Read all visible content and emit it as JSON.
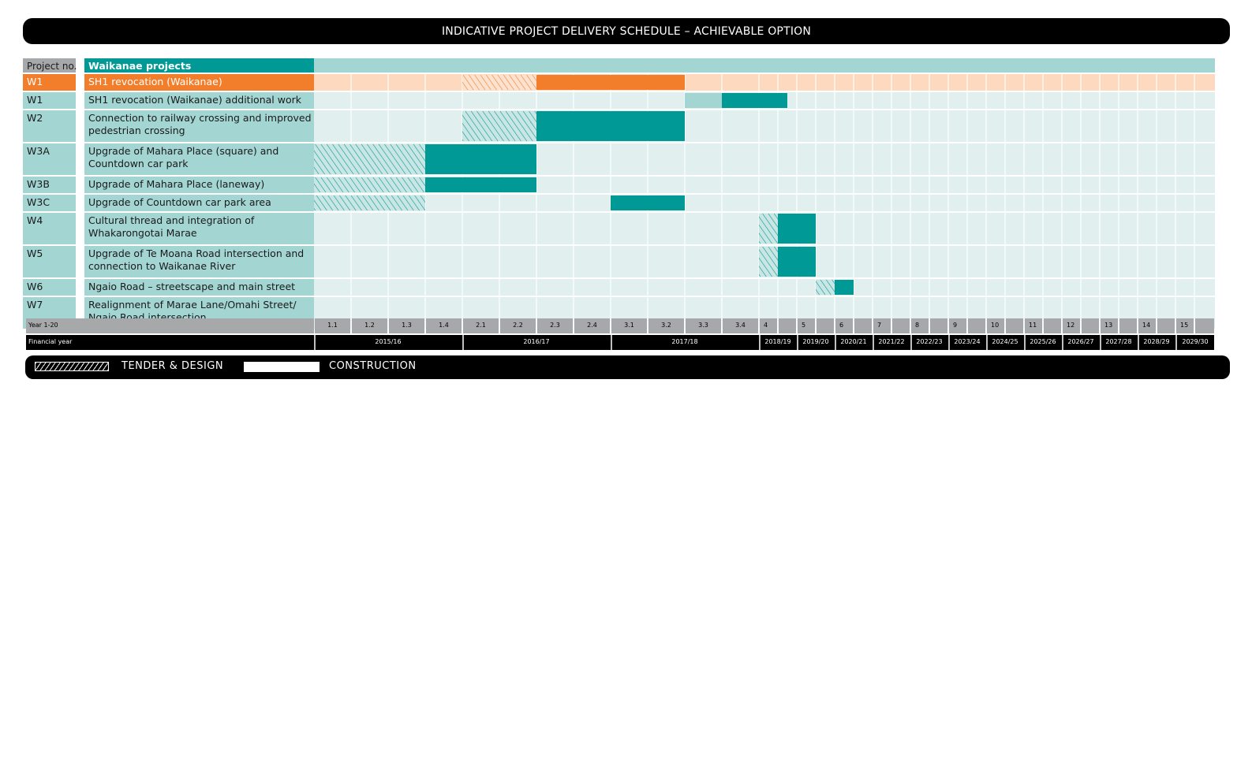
{
  "title": "INDICATIVE PROJECT DELIVERY SCHEDULE – ACHIEVABLE OPTION",
  "colors": {
    "teal": "#009995",
    "teal_light": "#a3d5d3",
    "teal_bg": "#e1f0ef",
    "orange": "#f27d2a",
    "orange_light": "#fcd9bf",
    "grey": "#a7a8aa",
    "black": "#000000"
  },
  "legend": {
    "tender_label": "TENDER & DESIGN",
    "construction_label": "CONSTRUCTION"
  },
  "chart_data": {
    "type": "gantt",
    "header": {
      "project_no_label": "Project no.",
      "group_label": "Waikanae projects"
    },
    "periods": [
      "1.1",
      "1.2",
      "1.3",
      "1.4",
      "2.1",
      "2.2",
      "2.3",
      "2.4",
      "3.1",
      "3.2",
      "3.3",
      "3.4",
      "4",
      "",
      "5",
      "",
      "6",
      "",
      "7",
      "",
      "8",
      "",
      "9",
      "",
      "10",
      "",
      "11",
      "",
      "12",
      "",
      "13",
      "",
      "14",
      "",
      "15",
      ""
    ],
    "period_axis_label": "Year 1-20",
    "financial_year_label": "Financial year",
    "financial_years": [
      {
        "label": "2015/16",
        "start": 0,
        "end": 4
      },
      {
        "label": "2016/17",
        "start": 4,
        "end": 8
      },
      {
        "label": "2017/18",
        "start": 8,
        "end": 12
      },
      {
        "label": "2018/19",
        "start": 12,
        "end": 14
      },
      {
        "label": "2019/20",
        "start": 14,
        "end": 16
      },
      {
        "label": "2020/21",
        "start": 16,
        "end": 18
      },
      {
        "label": "2021/22",
        "start": 18,
        "end": 20
      },
      {
        "label": "2022/23",
        "start": 20,
        "end": 22
      },
      {
        "label": "2023/24",
        "start": 22,
        "end": 24
      },
      {
        "label": "2024/25",
        "start": 24,
        "end": 26
      },
      {
        "label": "2025/26",
        "start": 26,
        "end": 28
      },
      {
        "label": "2026/27",
        "start": 28,
        "end": 30
      },
      {
        "label": "2027/28",
        "start": 30,
        "end": 32
      },
      {
        "label": "2028/29",
        "start": 32,
        "end": 34
      },
      {
        "label": "2029/30",
        "start": 34,
        "end": 36
      }
    ],
    "projects": [
      {
        "no": "W1",
        "name": [
          "SH1 revocation (Waikanae)"
        ],
        "highlight": true,
        "tender": [
          4,
          6
        ],
        "construction": [
          6,
          10
        ]
      },
      {
        "no": "W1",
        "name": [
          "SH1 revocation (Waikanae) additional work"
        ],
        "other": [
          10,
          11
        ],
        "construction": [
          11,
          13.5
        ]
      },
      {
        "no": "W2",
        "name": [
          "Connection to railway crossing and improved",
          "pedestrian crossing"
        ],
        "tender": [
          4,
          6
        ],
        "construction": [
          6,
          10
        ]
      },
      {
        "no": "W3A",
        "name": [
          "Upgrade of Mahara Place (square) and",
          "Countdown car park"
        ],
        "tender": [
          0,
          3
        ],
        "construction": [
          3,
          6
        ]
      },
      {
        "no": "W3B",
        "name": [
          "Upgrade of Mahara Place (laneway)"
        ],
        "tender": [
          0,
          3
        ],
        "construction": [
          3,
          6
        ]
      },
      {
        "no": "W3C",
        "name": [
          "Upgrade of Countdown car park area"
        ],
        "tender": [
          0,
          3
        ],
        "construction": [
          8,
          10
        ]
      },
      {
        "no": "W4",
        "name": [
          "Cultural thread and integration of",
          "Whakarongotai Marae"
        ],
        "tender": [
          12,
          13
        ],
        "construction": [
          13,
          15
        ]
      },
      {
        "no": "W5",
        "name": [
          "Upgrade of Te Moana Road intersection and",
          "connection to Waikanae River"
        ],
        "tender": [
          12,
          13
        ],
        "construction": [
          13,
          15
        ]
      },
      {
        "no": "W6",
        "name": [
          "Ngaio Road – streetscape and main street"
        ],
        "tender": [
          15,
          16
        ],
        "construction": [
          16,
          17
        ]
      },
      {
        "no": "W7",
        "name": [
          "Realignment of Marae Lane/Omahi Street/",
          "Ngaio Road intersection"
        ]
      }
    ]
  }
}
